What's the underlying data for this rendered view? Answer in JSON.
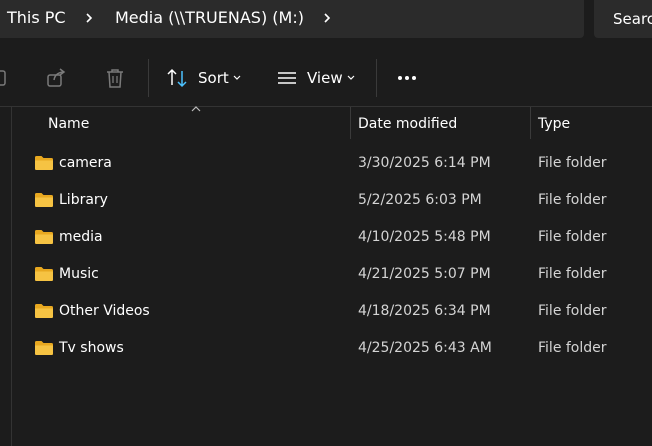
{
  "address": {
    "crumbs": [
      "This PC",
      "Media (\\\\TRUENAS) (M:)"
    ]
  },
  "search": {
    "text": "Searc"
  },
  "toolbar": {
    "sort_label": "Sort",
    "view_label": "View"
  },
  "columns": {
    "name": "Name",
    "date": "Date modified",
    "type": "Type"
  },
  "files": [
    {
      "name": "camera",
      "date": "3/30/2025 6:14 PM",
      "type": "File folder"
    },
    {
      "name": "Library",
      "date": "5/2/2025 6:03 PM",
      "type": "File folder"
    },
    {
      "name": "media",
      "date": "4/10/2025 5:48 PM",
      "type": "File folder"
    },
    {
      "name": "Music",
      "date": "4/21/2025 5:07 PM",
      "type": "File folder"
    },
    {
      "name": "Other Videos",
      "date": "4/18/2025 6:34 PM",
      "type": "File folder"
    },
    {
      "name": "Tv shows",
      "date": "4/25/2025 6:43 AM",
      "type": "File folder"
    }
  ],
  "colors": {
    "background": "#1c1c1c",
    "folder": "#f6c343",
    "accent": "#4cc2ff"
  }
}
